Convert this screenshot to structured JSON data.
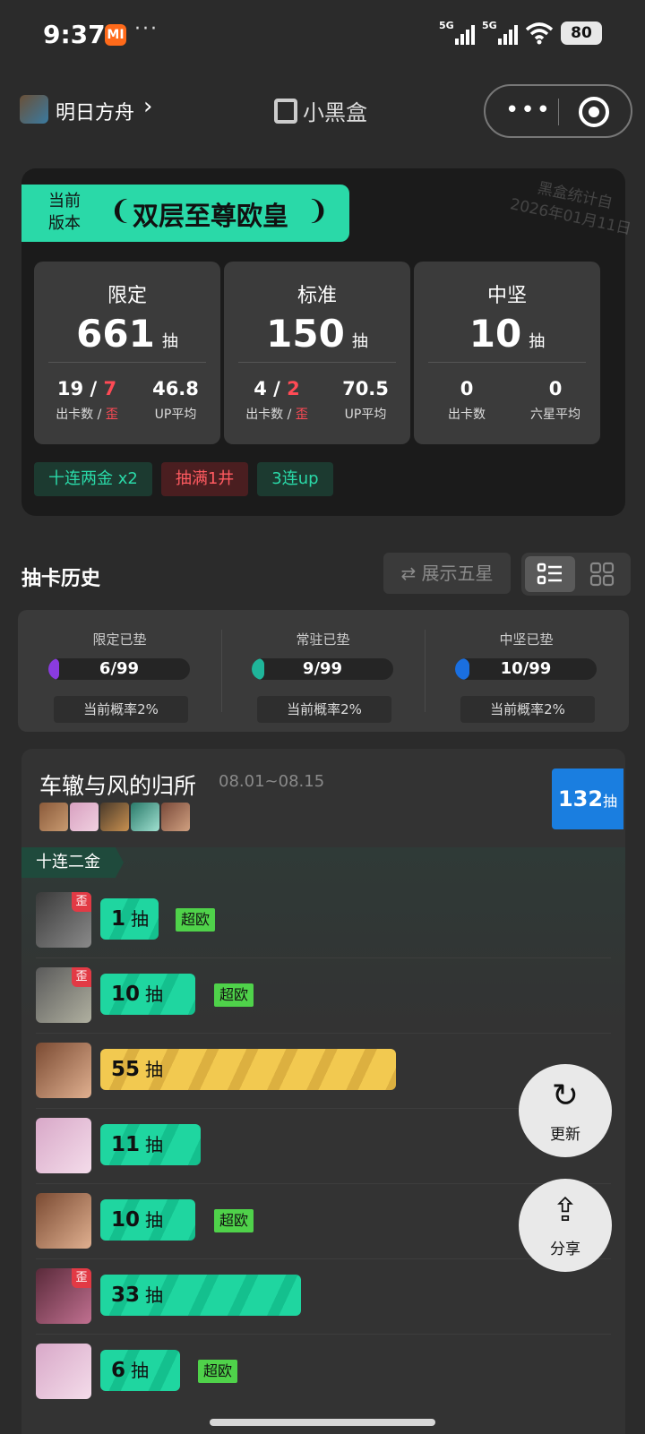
{
  "status_bar": {
    "time": "9:37",
    "mi_icon": "MI",
    "dots": "···",
    "net1": "5G",
    "net2": "5G",
    "battery": "80"
  },
  "nav": {
    "game_name": "明日方舟",
    "chevron": "›",
    "app_title": "小黑盒",
    "more": "•••"
  },
  "summary": {
    "ribbon_small": "当前版本",
    "ribbon_title": "双层至尊欧皇",
    "laurel_left": "❨",
    "laurel_right": "❩",
    "stamp_line1": "黑盒统计自",
    "stamp_line2": "2026年01月11日",
    "stats": [
      {
        "name": "限定",
        "total": "661",
        "unit": "抽",
        "c1_a": "19",
        "c1_sep": " / ",
        "c1_b": "7",
        "c1_label_a": "出卡数 / ",
        "c1_label_b": "歪",
        "c2_val": "46.8",
        "c2_label": "UP平均"
      },
      {
        "name": "标准",
        "total": "150",
        "unit": "抽",
        "c1_a": "4",
        "c1_sep": " / ",
        "c1_b": "2",
        "c1_label_a": "出卡数 / ",
        "c1_label_b": "歪",
        "c2_val": "70.5",
        "c2_label": "UP平均"
      },
      {
        "name": "中坚",
        "total": "10",
        "unit": "抽",
        "c1_a": "0",
        "c1_label_a": "出卡数",
        "c2_val": "0",
        "c2_label": "六星平均"
      }
    ],
    "chips": [
      "十连两金  x2",
      "抽满1井",
      "3连up"
    ]
  },
  "history": {
    "title": "抽卡历史",
    "show_five_star": "⇄ 展示五星"
  },
  "pity": [
    {
      "title": "限定已垫",
      "value": "6/99",
      "rate": "当前概率2%",
      "color": "#8a3be0",
      "level": 0.06
    },
    {
      "title": "常驻已垫",
      "value": "9/99",
      "rate": "当前概率2%",
      "color": "#1fb59a",
      "level": 0.09
    },
    {
      "title": "中坚已垫",
      "value": "10/99",
      "rate": "当前概率2%",
      "color": "#1a6fe0",
      "level": 0.1
    }
  ],
  "banner": {
    "name": "车辙与风的归所",
    "dates": "08.01~08.15",
    "total": "132",
    "total_unit": "抽",
    "group_tag": "十连二金",
    "rows": [
      {
        "pulls": "1",
        "unit": "抽",
        "wai": "歪",
        "tag": "超欧",
        "color": "green",
        "fraction": 0.11
      },
      {
        "pulls": "10",
        "unit": "抽",
        "wai": "歪",
        "tag": "超欧",
        "color": "green",
        "fraction": 0.18
      },
      {
        "pulls": "55",
        "unit": "抽",
        "wai": "",
        "tag": "",
        "color": "gold",
        "fraction": 0.56
      },
      {
        "pulls": "11",
        "unit": "抽",
        "wai": "",
        "tag": "",
        "color": "green",
        "fraction": 0.19
      },
      {
        "pulls": "10",
        "unit": "抽",
        "wai": "",
        "tag": "超欧",
        "color": "green",
        "fraction": 0.18
      },
      {
        "pulls": "33",
        "unit": "抽",
        "wai": "歪",
        "tag": "",
        "color": "green",
        "fraction": 0.38
      },
      {
        "pulls": "6",
        "unit": "抽",
        "wai": "",
        "tag": "超欧",
        "color": "green",
        "fraction": 0.15
      }
    ]
  },
  "fabs": {
    "refresh_icon": "↻",
    "refresh_label": "更新",
    "share_icon": "⇪",
    "share_label": "分享"
  }
}
